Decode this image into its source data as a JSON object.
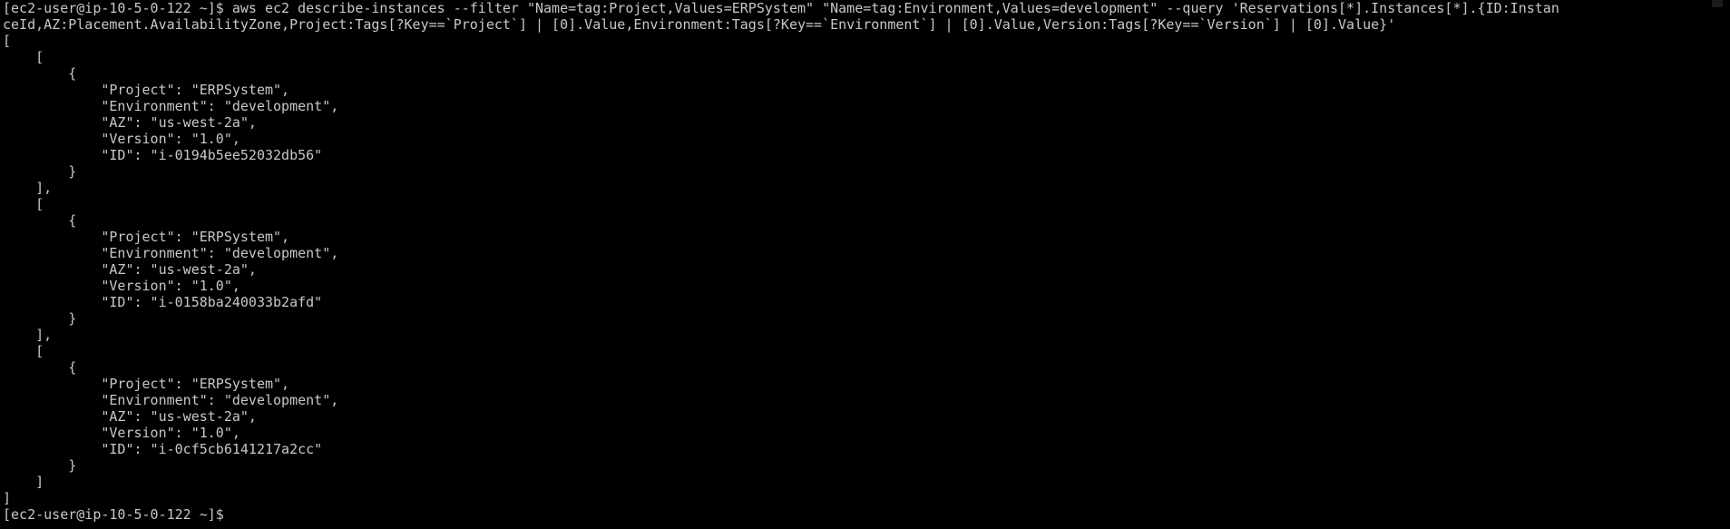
{
  "terminal": {
    "lines": [
      "[ec2-user@ip-10-5-0-122 ~]$ aws ec2 describe-instances --filter \"Name=tag:Project,Values=ERPSystem\" \"Name=tag:Environment,Values=development\" --query 'Reservations[*].Instances[*].{ID:Instan",
      "ceId,AZ:Placement.AvailabilityZone,Project:Tags[?Key==`Project`] | [0].Value,Environment:Tags[?Key==`Environment`] | [0].Value,Version:Tags[?Key==`Version`] | [0].Value}'",
      "[",
      "    [",
      "        {",
      "            \"Project\": \"ERPSystem\",",
      "            \"Environment\": \"development\",",
      "            \"AZ\": \"us-west-2a\",",
      "            \"Version\": \"1.0\",",
      "            \"ID\": \"i-0194b5ee52032db56\"",
      "        }",
      "    ],",
      "    [",
      "        {",
      "            \"Project\": \"ERPSystem\",",
      "            \"Environment\": \"development\",",
      "            \"AZ\": \"us-west-2a\",",
      "            \"Version\": \"1.0\",",
      "            \"ID\": \"i-0158ba240033b2afd\"",
      "        }",
      "    ],",
      "    [",
      "        {",
      "            \"Project\": \"ERPSystem\",",
      "            \"Environment\": \"development\",",
      "            \"AZ\": \"us-west-2a\",",
      "            \"Version\": \"1.0\",",
      "            \"ID\": \"i-0cf5cb6141217a2cc\"",
      "        }",
      "    ]",
      "]"
    ],
    "prompt": "[ec2-user@ip-10-5-0-122 ~]$ "
  },
  "colors": {
    "background": "#000000",
    "foreground": "#c8c8c8"
  }
}
